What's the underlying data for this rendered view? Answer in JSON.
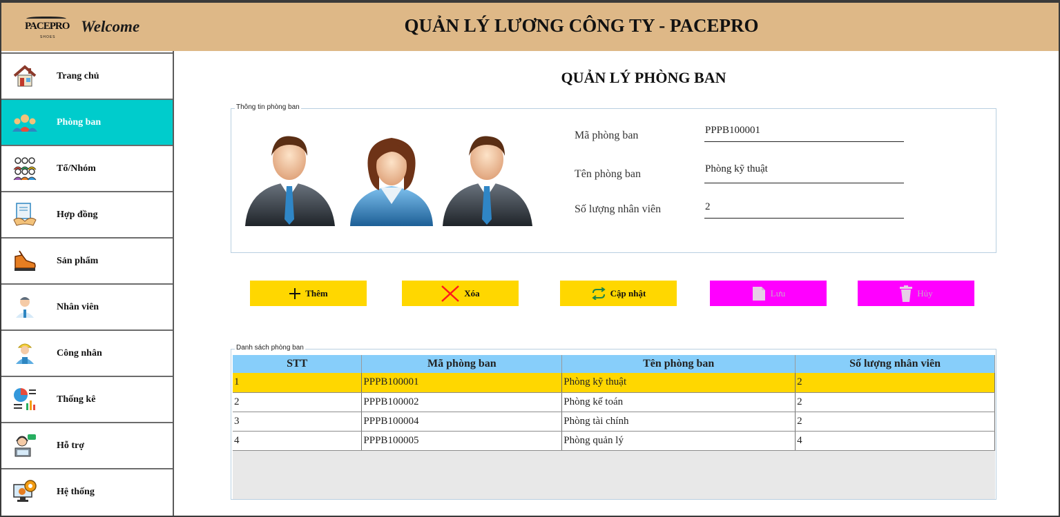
{
  "header": {
    "brand": "PACEPRO",
    "brand_sub": "SHOES",
    "welcome": "Welcome",
    "title": "QUẢN LÝ LƯƠNG CÔNG TY - PACEPRO"
  },
  "sidebar": {
    "items": [
      {
        "label": "Trang chủ",
        "icon": "house-icon"
      },
      {
        "label": "Phòng ban",
        "icon": "team-icon",
        "active": true
      },
      {
        "label": "Tổ/Nhóm",
        "icon": "group-icon"
      },
      {
        "label": "Hợp đồng",
        "icon": "contract-icon"
      },
      {
        "label": "Sản phẩm",
        "icon": "shoe-icon"
      },
      {
        "label": "Nhân viên",
        "icon": "employee-icon"
      },
      {
        "label": "Công nhân",
        "icon": "worker-icon"
      },
      {
        "label": "Thống kê",
        "icon": "chart-icon"
      },
      {
        "label": "Hỗ trợ",
        "icon": "support-icon"
      },
      {
        "label": "Hệ thống",
        "icon": "settings-icon"
      }
    ]
  },
  "main": {
    "title": "QUẢN LÝ PHÒNG BAN",
    "info_legend": "Thông tin phòng ban",
    "form": {
      "ma_label": "Mã phòng ban",
      "ma_value": "PPPB100001",
      "ten_label": "Tên phòng ban",
      "ten_value": "Phòng kỹ thuật",
      "sl_label": "Số lượng nhân viên",
      "sl_value": "2"
    },
    "buttons": {
      "add": "Thêm",
      "delete": "Xóa",
      "update": "Cập nhật",
      "save": "Lưu",
      "cancel": "Hủy"
    },
    "list_legend": "Danh sách phòng ban",
    "table": {
      "headers": [
        "STT",
        "Mã phòng ban",
        "Tên phòng ban",
        "Số lượng nhân viên"
      ],
      "rows": [
        [
          "1",
          "PPPB100001",
          "Phòng kỹ thuật",
          "2"
        ],
        [
          "2",
          "PPPB100002",
          "Phòng kế toán",
          "2"
        ],
        [
          "3",
          "PPPB100004",
          "Phòng tài chính",
          "2"
        ],
        [
          "4",
          "PPPB100005",
          "Phòng quản lý",
          "4"
        ]
      ],
      "selected_row": 0
    }
  },
  "colors": {
    "header_bg": "#deb887",
    "active_nav": "#00cccc",
    "yellow_button": "#ffd700",
    "magenta_button": "#ff00ff",
    "table_header": "#87cefa",
    "selected_row": "#ffd700"
  }
}
